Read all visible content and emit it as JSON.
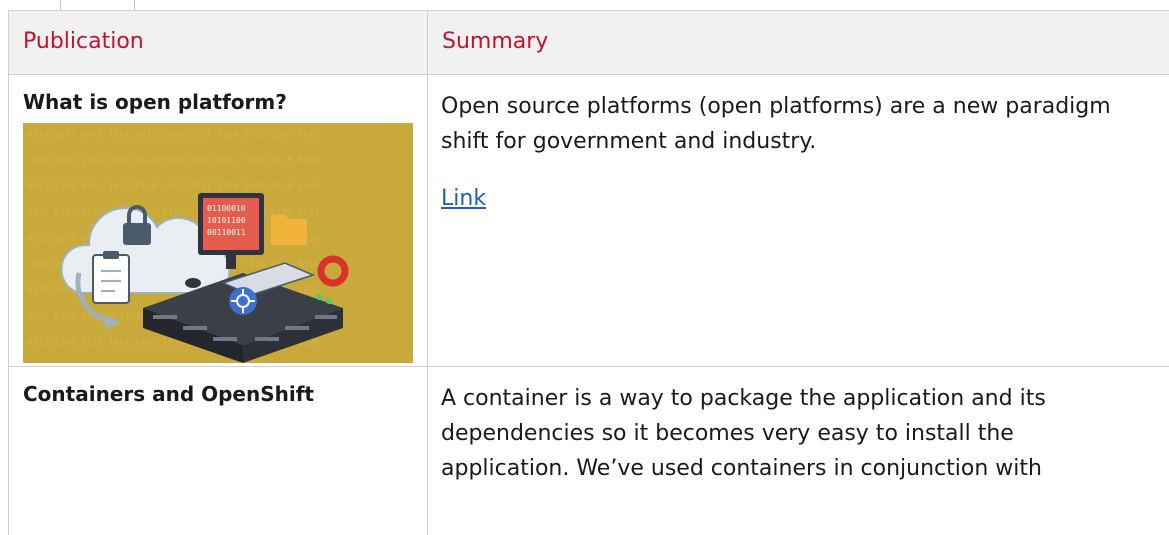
{
  "table": {
    "headers": {
      "publication": "Publication",
      "summary": "Summary"
    },
    "rows": [
      {
        "title": "What is open platform?",
        "summary": "Open source platforms (open platforms) are a new paradigm shift for government and industry.",
        "link_label": "Link",
        "image_icon": "server-cloud-illustration"
      },
      {
        "title": "Containers and OpenShift",
        "summary": "A container is a way to package the application and its dependencies so it becomes very easy to install the application. We’ve used containers in conjunction with"
      }
    ]
  },
  "colors": {
    "header_text": "#c8102e",
    "header_bg": "#f1f1f1",
    "link": "#1f5fbf",
    "border": "#cfcfcf",
    "image_bg": "#c8a93a"
  }
}
